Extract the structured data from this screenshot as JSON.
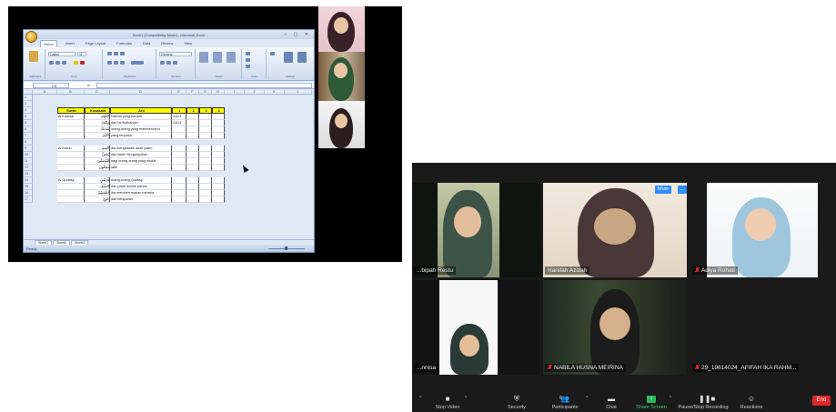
{
  "excel": {
    "title": "Book1 [Compatibility Mode] - Microsoft Excel",
    "tabs": [
      "Home",
      "Insert",
      "Page Layout",
      "Formulas",
      "Data",
      "Review",
      "View"
    ],
    "ribbon_groups": [
      "Clipboard",
      "Font",
      "Alignment",
      "Number",
      "Styles",
      "Cells",
      "Editing"
    ],
    "font_name": "Calibri",
    "font_size": "11",
    "number_format": "General",
    "name_box": "C9",
    "fx": "fx",
    "columns": [
      "A",
      "B",
      "C",
      "D",
      "E",
      "F",
      "G",
      "H",
      "I",
      "J",
      "K",
      "L"
    ],
    "rows": [
      "1",
      "2",
      "3",
      "4",
      "5",
      "6",
      "7",
      "8",
      "9",
      "10",
      "11",
      "12",
      "13",
      "14",
      "15",
      "16",
      "17"
    ],
    "header_row": [
      "Surah",
      "Kosakata",
      "Arti",
      "1",
      "2",
      "3",
      "4"
    ],
    "cells": [
      {
        "r": 3,
        "b": "Al Kautsar",
        "c": "الْكَوْثَرَ",
        "d": "Nikmat yang banyak",
        "e": "11111"
      },
      {
        "r": 4,
        "c": "وَانْحَرْ",
        "d": "dan berkurbanlah",
        "e": "11111"
      },
      {
        "r": 5,
        "c": "شَانِئَكَ",
        "d": "orang-orang yang membencimu"
      },
      {
        "r": 6,
        "c": "الْأَبْتَرُ",
        "d": "yang terputus"
      },
      {
        "r": 8,
        "b": "Al Ma'un",
        "c": "الْيَتِيمَ",
        "d": "dia menghardik anak yatim"
      },
      {
        "r": 9,
        "c": "يَحُضُّ",
        "d": "dan tidak menganjurkan"
      },
      {
        "r": 10,
        "c": "لِلْمُصَلِّينَ",
        "d": "bagi orang-orang yang sholat"
      },
      {
        "r": 11,
        "c": "سَاهُونَ",
        "d": "lalai"
      },
      {
        "r": 13,
        "b": "Al Quraisy",
        "c": "قُرَيْشٍ",
        "d": "orang-orang Quraisy"
      },
      {
        "r": 14,
        "c": "الصَّيْفِ",
        "d": "dan pada musim panas"
      },
      {
        "r": 15,
        "c": "أَطْعَمَهُمْ",
        "d": "dia memberi makan mereka"
      },
      {
        "r": 16,
        "c": "جُوعٍ",
        "d": "dari kelaparan"
      }
    ],
    "sheets": [
      "Sheet1",
      "Sheet2",
      "Sheet3"
    ],
    "status": "Ready"
  },
  "zoom": {
    "mute_label": "Mute",
    "more_label": "...",
    "participants": [
      {
        "name": "...bipah Restu",
        "muted": false
      },
      {
        "name": "Hanifah Azizah",
        "muted": false
      },
      {
        "name": "Adiya Rohati",
        "muted": true
      },
      {
        "name": "...nnisa",
        "muted": false
      },
      {
        "name": "NABILA HUSNA MEIRINA",
        "muted": true
      },
      {
        "name": "29_19614024_AFIFAH IKA RAHM...",
        "muted": true
      }
    ],
    "toolbar": {
      "stop_video": "Stop Video",
      "security": "Security",
      "participants": "Participants",
      "participants_count": "6",
      "chat": "Chat",
      "share_screen": "Share Screen",
      "recording": "Pause/Stop Recording",
      "reactions": "Reactions",
      "end": "End"
    },
    "colors": {
      "active_speaker": "#b9d23c",
      "end": "#e02828",
      "share": "#2fb45e",
      "mute": "#2d8cff"
    }
  }
}
